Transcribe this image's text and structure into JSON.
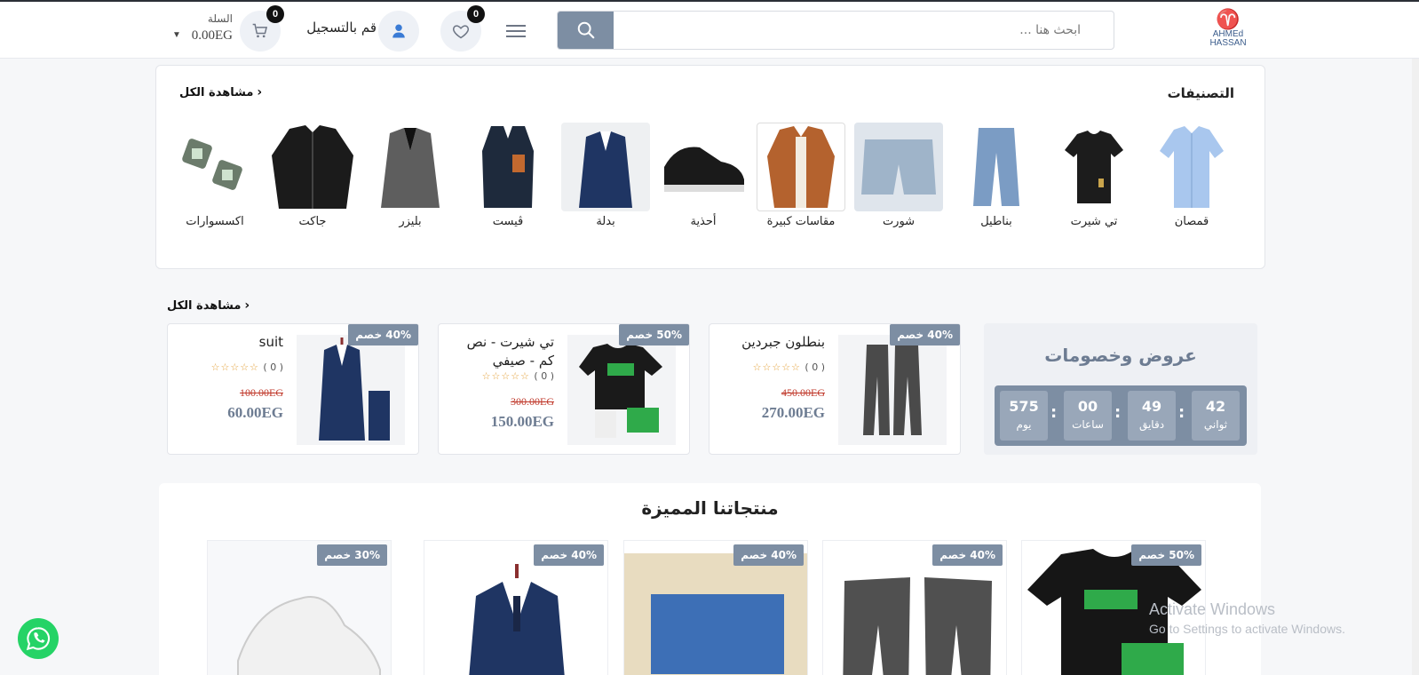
{
  "header": {
    "logo_line1": "AHMEd",
    "logo_line2": "HASSAN",
    "search_placeholder": "ابحث هنا ...",
    "wishlist_count": "0",
    "login_label": "قم بالتسجيل",
    "cart_count": "0",
    "cart_label": "السلة",
    "cart_total": "0.00EG"
  },
  "categories": {
    "title": "التصنيفات",
    "see_all": "مشاهدة الكل",
    "items": [
      {
        "label": "قمصان",
        "color": "#a9c7ee"
      },
      {
        "label": "تي شيرت",
        "color": "#1c1c1c"
      },
      {
        "label": "بناطيل",
        "color": "#7b9cc4"
      },
      {
        "label": "شورت",
        "color": "#9fb4c9"
      },
      {
        "label": "مقاسات كبيرة",
        "color": "#b4622e"
      },
      {
        "label": "أحذية",
        "color": "#1a1a1a"
      },
      {
        "label": "بدلة",
        "color": "#1f3563"
      },
      {
        "label": "ڤيست",
        "color": "#1e2a3c"
      },
      {
        "label": "بليزر",
        "color": "#5e5e5e"
      },
      {
        "label": "جاكت",
        "color": "#1b1b1b"
      },
      {
        "label": "اكسسوارات",
        "color": "#6b7b6b"
      }
    ]
  },
  "offers": {
    "see_all": "مشاهدة الكل",
    "title": "عروض وخصومات",
    "countdown": [
      {
        "value": "42",
        "label": "ثواني"
      },
      {
        "value": "49",
        "label": "دقايق"
      },
      {
        "value": "00",
        "label": "ساعات"
      },
      {
        "value": "575",
        "label": "يوم"
      }
    ],
    "deals": [
      {
        "badge": "40% خصم",
        "name": "بنطلون جبردين",
        "rating_count": "( 0 )",
        "old_price": "450.00EG",
        "new_price": "270.00EG",
        "color": "#4a4a4a"
      },
      {
        "badge": "50% خصم",
        "name": "تي شيرت - نص كم - صيفي",
        "rating_count": "( 0 )",
        "old_price": "300.00EG",
        "new_price": "150.00EG",
        "color": "#1a1a1a"
      },
      {
        "badge": "40% خصم",
        "name": "suit",
        "rating_count": "( 0 )",
        "old_price": "100.00EG",
        "new_price": "60.00EG",
        "color": "#1f3563"
      }
    ]
  },
  "featured": {
    "title": "منتجاتنا المميزة",
    "products": [
      {
        "badge": "50% خصم",
        "color": "#161616"
      },
      {
        "badge": "40% خصم",
        "color": "#505050"
      },
      {
        "badge": "40% خصم",
        "color": "#e8dcc0"
      },
      {
        "badge": "40% خصم",
        "color": "#1f3563"
      },
      {
        "badge": "30% خصم",
        "color": "#f1f1f1"
      }
    ]
  },
  "os_watermark": {
    "line1": "Activate Windows",
    "line2": "Go to Settings to activate Windows."
  }
}
